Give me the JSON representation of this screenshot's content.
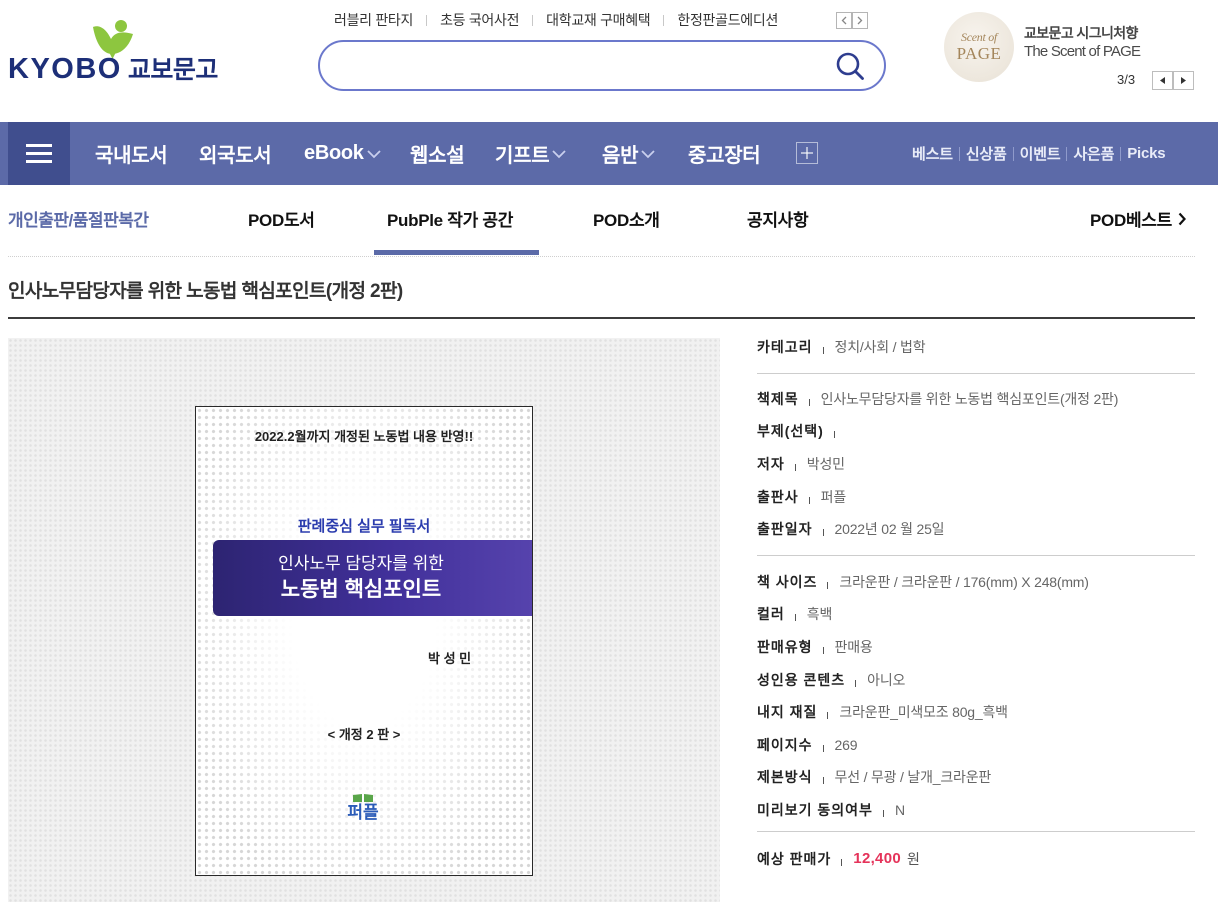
{
  "header": {
    "logo": {
      "latin": "KYOBO",
      "korean": "교보문고"
    },
    "top_links": [
      "러블리 판타지",
      "초등 국어사전",
      "대학교재 구매혜택",
      "한정판골드에디션"
    ],
    "search": {
      "placeholder": "",
      "value": ""
    },
    "promo": {
      "badge_top": "Scent of",
      "badge_bottom": "PAGE",
      "title": "교보문고 시그니처향",
      "subtitle": "The Scent of PAGE",
      "counter": "3/3"
    }
  },
  "nav": {
    "items": [
      {
        "label": "국내도서",
        "has_dropdown": false
      },
      {
        "label": "외국도서",
        "has_dropdown": false
      },
      {
        "label": "eBook",
        "has_dropdown": true
      },
      {
        "label": "웹소설",
        "has_dropdown": false
      },
      {
        "label": "기프트",
        "has_dropdown": true
      },
      {
        "label": "음반",
        "has_dropdown": true
      },
      {
        "label": "중고장터",
        "has_dropdown": false
      }
    ],
    "quick_links": [
      "베스트",
      "신상품",
      "이벤트",
      "사은품",
      "Picks"
    ]
  },
  "sub_nav": {
    "brand": "개인출판/품절판복간",
    "tabs": [
      {
        "label": "POD도서",
        "active": false
      },
      {
        "label": "PubPle 작가 공간",
        "active": true
      },
      {
        "label": "POD소개",
        "active": false
      },
      {
        "label": "공지사항",
        "active": false
      }
    ],
    "right_link": "POD베스트"
  },
  "product": {
    "title": "인사노무담당자를 위한 노동법 핵심포인트(개정 2판)",
    "cover": {
      "headline": "2022.2월까지 개정된 노동법 내용 반영!!",
      "tagline": "판례중심 실무 필독서",
      "title_line1": "인사노무 담당자를 위한",
      "title_line2": "노동법 핵심포인트",
      "author": "박 성 민",
      "edition": "< 개정 2 판 >",
      "publisher_logo": "퍼플"
    },
    "details": {
      "category": [
        {
          "label": "카테고리",
          "value": "정치/사회 / 법학"
        }
      ],
      "book_info": [
        {
          "label": "책제목",
          "value": "인사노무담당자를 위한 노동법 핵심포인트(개정 2판)"
        },
        {
          "label": "부제(선택)",
          "value": ""
        },
        {
          "label": "저자",
          "value": "박성민"
        },
        {
          "label": "출판사",
          "value": "퍼플"
        },
        {
          "label": "출판일자",
          "value": "2022년 02 월 25일"
        }
      ],
      "specs": [
        {
          "label": "책 사이즈",
          "value": "크라운판 / 크라운판 / 176(mm) X 248(mm)"
        },
        {
          "label": "컬러",
          "value": "흑백"
        },
        {
          "label": "판매유형",
          "value": "판매용"
        },
        {
          "label": "성인용 콘텐츠",
          "value": "아니오"
        },
        {
          "label": "내지 재질",
          "value": "크라운판_미색모조 80g_흑백"
        },
        {
          "label": "페이지수",
          "value": "269"
        },
        {
          "label": "제본방식",
          "value": "무선 / 무광 / 날개_크라운판"
        },
        {
          "label": "미리보기 동의여부",
          "value": "N"
        }
      ],
      "price": {
        "label": "예상 판매가",
        "value": "12,400",
        "unit": "원"
      }
    }
  },
  "icons": {
    "logo": "bird-leaf-icon",
    "search": "search-icon",
    "menu": "hamburger-icon",
    "dropdown": "chevron-down-icon",
    "add": "plus-square-icon",
    "more": "chevron-right-icon"
  },
  "colors": {
    "nav_background": "#5c6aa8",
    "nav_menu_background": "#404e8e",
    "accent": "#5b6aa8",
    "price": "#e5335a",
    "logo_text": "#1d2f78",
    "logo_leaf": "#8dc63f"
  }
}
